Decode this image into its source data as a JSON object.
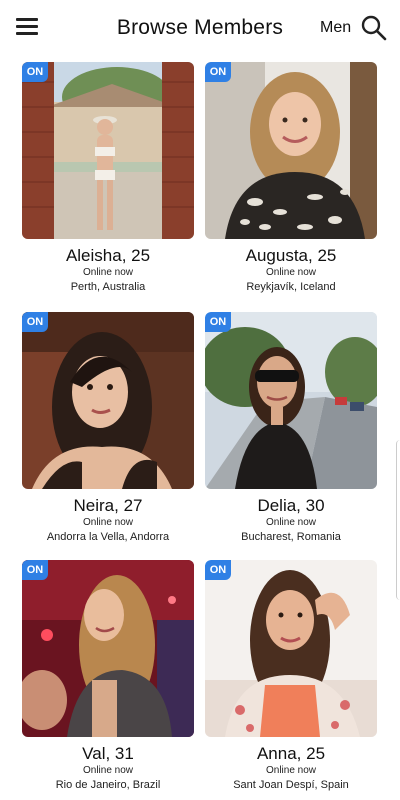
{
  "header": {
    "title": "Browse Members",
    "filter_label": "Men",
    "menu_icon": "hamburger-menu-icon",
    "search_icon": "search-icon"
  },
  "members": [
    {
      "name_age": "Aleisha, 25",
      "status": "Online now",
      "location": "Perth, Australia",
      "badge": "ON"
    },
    {
      "name_age": "Augusta, 25",
      "status": "Online now",
      "location": "Reykjavík, Iceland",
      "badge": "ON"
    },
    {
      "name_age": "Neira, 27",
      "status": "Online now",
      "location": "Andorra la Vella, Andorra",
      "badge": "ON"
    },
    {
      "name_age": "Delia, 30",
      "status": "Online now",
      "location": "Bucharest, Romania",
      "badge": "ON"
    },
    {
      "name_age": "Val, 31",
      "status": "Online now",
      "location": "Rio de Janeiro, Brazil",
      "badge": "ON"
    },
    {
      "name_age": "Anna, 25",
      "status": "Online now",
      "location": "Sant Joan Despí, Spain",
      "badge": "ON"
    }
  ],
  "colors": {
    "badge": "#2f80e5",
    "text": "#111111"
  }
}
